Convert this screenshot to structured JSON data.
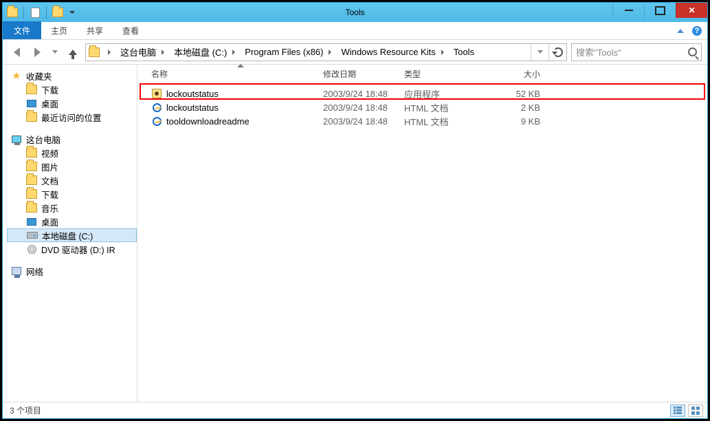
{
  "window": {
    "title": "Tools"
  },
  "ribbon": {
    "file": "文件",
    "tabs": [
      "主页",
      "共享",
      "查看"
    ]
  },
  "breadcrumb": [
    "这台电脑",
    "本地磁盘 (C:)",
    "Program Files (x86)",
    "Windows Resource Kits",
    "Tools"
  ],
  "search": {
    "placeholder": "搜索\"Tools\""
  },
  "tree": {
    "favorites": {
      "label": "收藏夹",
      "items": [
        "下载",
        "桌面",
        "最近访问的位置"
      ]
    },
    "this_pc": {
      "label": "这台电脑",
      "items": [
        "视频",
        "图片",
        "文档",
        "下载",
        "音乐",
        "桌面",
        "本地磁盘 (C:)",
        "DVD 驱动器 (D:) IR"
      ]
    },
    "network": {
      "label": "网络"
    }
  },
  "columns": {
    "name": "名称",
    "date": "修改日期",
    "type": "类型",
    "size": "大小"
  },
  "files": [
    {
      "name": "lockoutstatus",
      "date": "2003/9/24 18:48",
      "type": "应用程序",
      "size": "52 KB",
      "icon": "exe"
    },
    {
      "name": "lockoutstatus",
      "date": "2003/9/24 18:48",
      "type": "HTML 文档",
      "size": "2 KB",
      "icon": "html"
    },
    {
      "name": "tooldownloadreadme",
      "date": "2003/9/24 18:48",
      "type": "HTML 文档",
      "size": "9 KB",
      "icon": "html"
    }
  ],
  "status": {
    "count": "3 个项目"
  }
}
